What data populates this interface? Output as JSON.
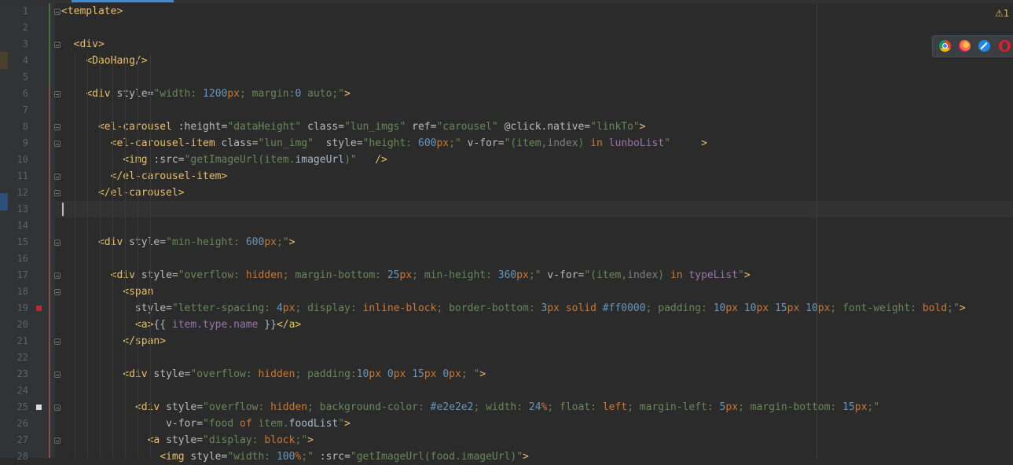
{
  "editor": {
    "warning_badge": "⚠1",
    "browsers": [
      "chrome-icon",
      "firefox-icon",
      "safari-icon",
      "opera-icon"
    ],
    "current_line": 13,
    "lines": [
      {
        "n": "1",
        "tokens": [
          [
            "tag",
            "<template>"
          ]
        ]
      },
      {
        "n": "2",
        "tokens": []
      },
      {
        "n": "3",
        "tokens": [
          [
            "plain",
            "  "
          ],
          [
            "tag",
            "<div>"
          ]
        ]
      },
      {
        "n": "4",
        "tokens": [
          [
            "plain",
            "    "
          ],
          [
            "tag",
            "<DaoHang/>"
          ]
        ]
      },
      {
        "n": "5",
        "tokens": []
      },
      {
        "n": "6",
        "tokens": [
          [
            "plain",
            "    "
          ],
          [
            "tag",
            "<div "
          ],
          [
            "attr",
            "style="
          ],
          [
            "str",
            "\"width: "
          ],
          [
            "num",
            "1200"
          ],
          [
            "kw",
            "px"
          ],
          [
            "str",
            "; margin:"
          ],
          [
            "num",
            "0"
          ],
          [
            "str",
            " auto;\""
          ],
          [
            "tag",
            ">"
          ]
        ]
      },
      {
        "n": "7",
        "tokens": []
      },
      {
        "n": "8",
        "tokens": [
          [
            "plain",
            "      "
          ],
          [
            "tag",
            "<el-carousel "
          ],
          [
            "attr",
            ":height="
          ],
          [
            "str",
            "\"dataHeight\" "
          ],
          [
            "attr",
            "class="
          ],
          [
            "str",
            "\"lun_imgs\" "
          ],
          [
            "attr",
            "ref="
          ],
          [
            "str",
            "\"carousel\" "
          ],
          [
            "attr",
            "@click.native="
          ],
          [
            "str",
            "\"linkTo\""
          ],
          [
            "tag",
            ">"
          ]
        ]
      },
      {
        "n": "9",
        "tokens": [
          [
            "plain",
            "        "
          ],
          [
            "tag",
            "<el-carousel-item "
          ],
          [
            "attr",
            "class="
          ],
          [
            "str",
            "\"lun_img\"  "
          ],
          [
            "attr",
            "style="
          ],
          [
            "str",
            "\"height: "
          ],
          [
            "num",
            "600"
          ],
          [
            "kw",
            "px"
          ],
          [
            "str",
            ";\" "
          ],
          [
            "attr",
            "v-for="
          ],
          [
            "str",
            "\"(item,"
          ],
          [
            "dim",
            "index"
          ],
          [
            "str",
            ") "
          ],
          [
            "kw",
            "in"
          ],
          [
            "ident",
            " lunboList"
          ],
          [
            "str",
            "\"     "
          ],
          [
            "tag",
            ">"
          ]
        ]
      },
      {
        "n": "10",
        "tokens": [
          [
            "plain",
            "          "
          ],
          [
            "tag",
            "<img "
          ],
          [
            "attr",
            ":src="
          ],
          [
            "str",
            "\"getImageUrl(item."
          ],
          [
            "plain",
            "imageUrl"
          ],
          [
            "str",
            ")\"   "
          ],
          [
            "tag",
            "/>"
          ]
        ]
      },
      {
        "n": "11",
        "tokens": [
          [
            "plain",
            "        "
          ],
          [
            "tag",
            "</el-carousel-item>"
          ]
        ]
      },
      {
        "n": "12",
        "tokens": [
          [
            "plain",
            "      "
          ],
          [
            "tag",
            "</el-carousel>"
          ]
        ]
      },
      {
        "n": "13",
        "tokens": []
      },
      {
        "n": "14",
        "tokens": []
      },
      {
        "n": "15",
        "tokens": [
          [
            "plain",
            "      "
          ],
          [
            "tag",
            "<div "
          ],
          [
            "attr",
            "style="
          ],
          [
            "str",
            "\"min-height: "
          ],
          [
            "num",
            "600"
          ],
          [
            "kw",
            "px"
          ],
          [
            "str",
            ";\""
          ],
          [
            "tag",
            ">"
          ]
        ]
      },
      {
        "n": "16",
        "tokens": []
      },
      {
        "n": "17",
        "tokens": [
          [
            "plain",
            "        "
          ],
          [
            "tag",
            "<div "
          ],
          [
            "attr",
            "style="
          ],
          [
            "str",
            "\"overflow: "
          ],
          [
            "kw",
            "hidden"
          ],
          [
            "str",
            "; margin-bottom: "
          ],
          [
            "num",
            "25"
          ],
          [
            "kw",
            "px"
          ],
          [
            "str",
            "; min-height: "
          ],
          [
            "num",
            "360"
          ],
          [
            "kw",
            "px"
          ],
          [
            "str",
            ";\" "
          ],
          [
            "attr",
            "v-for="
          ],
          [
            "str",
            "\"(item,"
          ],
          [
            "dim",
            "index"
          ],
          [
            "str",
            ") "
          ],
          [
            "kw",
            "in"
          ],
          [
            "ident",
            " typeList"
          ],
          [
            "str",
            "\""
          ],
          [
            "tag",
            ">"
          ]
        ]
      },
      {
        "n": "18",
        "tokens": [
          [
            "plain",
            "          "
          ],
          [
            "tag",
            "<span"
          ]
        ]
      },
      {
        "n": "19",
        "tokens": [
          [
            "plain",
            "            "
          ],
          [
            "attr",
            "style="
          ],
          [
            "str",
            "\"letter-spacing: "
          ],
          [
            "num",
            "4"
          ],
          [
            "kw",
            "px"
          ],
          [
            "str",
            "; display: "
          ],
          [
            "kw",
            "inline-block"
          ],
          [
            "str",
            "; border-bottom: "
          ],
          [
            "num",
            "3"
          ],
          [
            "kw",
            "px solid "
          ],
          [
            "num",
            "#ff0000"
          ],
          [
            "str",
            "; padding: "
          ],
          [
            "num",
            "10"
          ],
          [
            "kw",
            "px "
          ],
          [
            "num",
            "10"
          ],
          [
            "kw",
            "px "
          ],
          [
            "num",
            "15"
          ],
          [
            "kw",
            "px "
          ],
          [
            "num",
            "10"
          ],
          [
            "kw",
            "px"
          ],
          [
            "str",
            "; font-weight: "
          ],
          [
            "kw",
            "bold"
          ],
          [
            "str",
            ";\""
          ],
          [
            "tag",
            ">"
          ]
        ]
      },
      {
        "n": "20",
        "tokens": [
          [
            "plain",
            "            "
          ],
          [
            "tag",
            "<a>"
          ],
          [
            "plain",
            "{{ "
          ],
          [
            "ident",
            "item.type.name"
          ],
          [
            "plain",
            " }}"
          ],
          [
            "tag",
            "</a>"
          ]
        ]
      },
      {
        "n": "21",
        "tokens": [
          [
            "plain",
            "          "
          ],
          [
            "tag",
            "</span>"
          ]
        ]
      },
      {
        "n": "22",
        "tokens": []
      },
      {
        "n": "23",
        "tokens": [
          [
            "plain",
            "          "
          ],
          [
            "tag",
            "<div "
          ],
          [
            "attr",
            "style="
          ],
          [
            "str",
            "\"overflow: "
          ],
          [
            "kw",
            "hidden"
          ],
          [
            "str",
            "; padding:"
          ],
          [
            "num",
            "10"
          ],
          [
            "kw",
            "px "
          ],
          [
            "num",
            "0"
          ],
          [
            "kw",
            "px "
          ],
          [
            "num",
            "15"
          ],
          [
            "kw",
            "px "
          ],
          [
            "num",
            "0"
          ],
          [
            "kw",
            "px"
          ],
          [
            "str",
            "; \""
          ],
          [
            "tag",
            ">"
          ]
        ]
      },
      {
        "n": "24",
        "tokens": []
      },
      {
        "n": "25",
        "tokens": [
          [
            "plain",
            "            "
          ],
          [
            "tag",
            "<div "
          ],
          [
            "attr",
            "style="
          ],
          [
            "str",
            "\"overflow: "
          ],
          [
            "kw",
            "hidden"
          ],
          [
            "str",
            "; background-color: "
          ],
          [
            "num",
            "#e2e2e2"
          ],
          [
            "str",
            "; width: "
          ],
          [
            "num",
            "24"
          ],
          [
            "kw",
            "%"
          ],
          [
            "str",
            "; float: "
          ],
          [
            "kw",
            "left"
          ],
          [
            "str",
            "; margin-left: "
          ],
          [
            "num",
            "5"
          ],
          [
            "kw",
            "px"
          ],
          [
            "str",
            "; margin-bottom: "
          ],
          [
            "num",
            "15"
          ],
          [
            "kw",
            "px"
          ],
          [
            "str",
            ";\""
          ]
        ]
      },
      {
        "n": "26",
        "tokens": [
          [
            "plain",
            "                 "
          ],
          [
            "attr",
            "v-for="
          ],
          [
            "str",
            "\"food "
          ],
          [
            "kw",
            "of"
          ],
          [
            "str",
            " item."
          ],
          [
            "plain",
            "foodList"
          ],
          [
            "str",
            "\""
          ],
          [
            "tag",
            ">"
          ]
        ]
      },
      {
        "n": "27",
        "tokens": [
          [
            "plain",
            "              "
          ],
          [
            "tag",
            "<a "
          ],
          [
            "attr",
            "style="
          ],
          [
            "str",
            "\"display: "
          ],
          [
            "kw",
            "block"
          ],
          [
            "str",
            ";\""
          ],
          [
            "tag",
            ">"
          ]
        ]
      },
      {
        "n": "28",
        "tokens": [
          [
            "plain",
            "                "
          ],
          [
            "tag",
            "<img "
          ],
          [
            "attr",
            "style="
          ],
          [
            "str",
            "\"width: "
          ],
          [
            "num",
            "100"
          ],
          [
            "kw",
            "%"
          ],
          [
            "str",
            ";\" "
          ],
          [
            "attr",
            ":src="
          ],
          [
            "str",
            "\"getImageUrl(food.imageUrl)\""
          ],
          [
            "tag",
            ">"
          ]
        ]
      }
    ]
  }
}
